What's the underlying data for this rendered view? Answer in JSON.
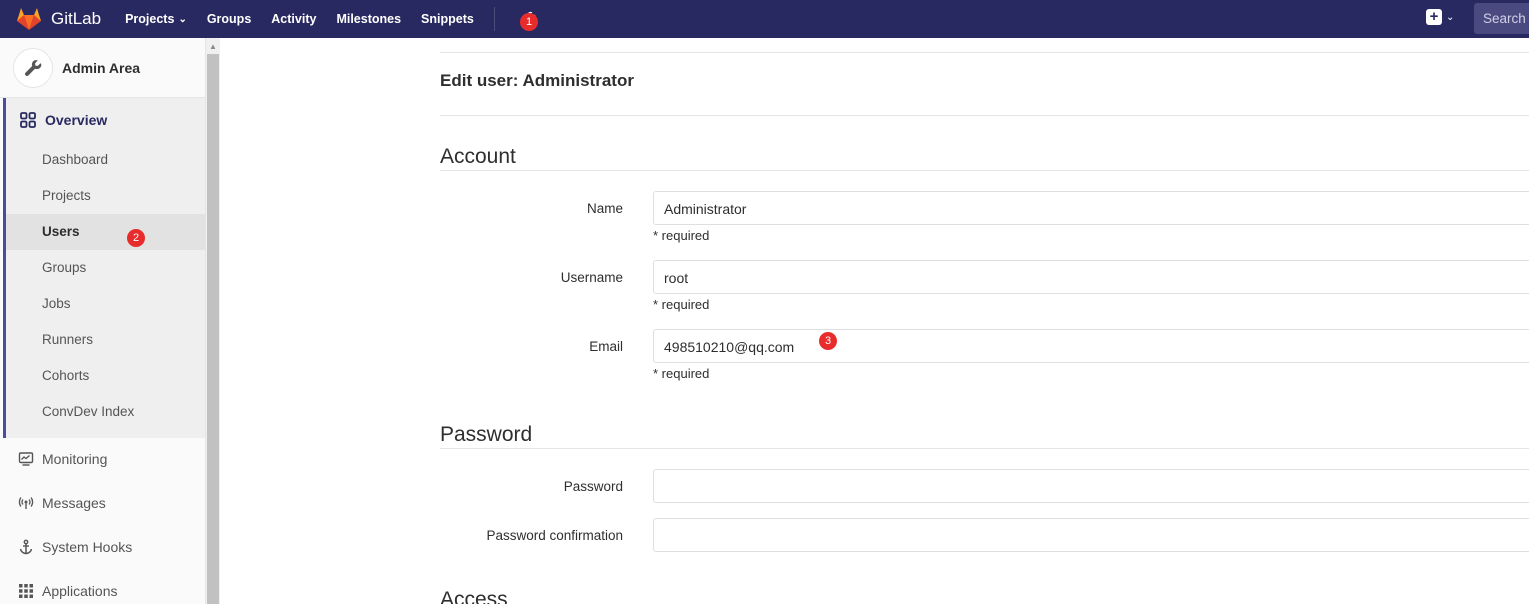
{
  "navbar": {
    "brand": "GitLab",
    "links": [
      "Projects",
      "Groups",
      "Activity",
      "Milestones",
      "Snippets"
    ],
    "admin_badge": "1",
    "search_placeholder": "Search",
    "colors": {
      "bg": "#292961",
      "badge": "#e82c2c"
    }
  },
  "sidebar": {
    "title": "Admin Area",
    "overview": {
      "label": "Overview",
      "items": [
        "Dashboard",
        "Projects",
        "Users",
        "Groups",
        "Jobs",
        "Runners",
        "Cohorts",
        "ConvDev Index"
      ],
      "active": "Users",
      "users_badge": "2"
    },
    "items": [
      {
        "label": "Monitoring",
        "icon": "monitor-icon"
      },
      {
        "label": "Messages",
        "icon": "broadcast-icon"
      },
      {
        "label": "System Hooks",
        "icon": "anchor-icon"
      },
      {
        "label": "Applications",
        "icon": "grid-icon"
      }
    ]
  },
  "main": {
    "title": "Edit user: Administrator",
    "account": {
      "heading": "Account",
      "fields": [
        {
          "label": "Name",
          "value": "Administrator",
          "help": "* required"
        },
        {
          "label": "Username",
          "value": "root",
          "help": "* required"
        },
        {
          "label": "Email",
          "value": "498510210@qq.com",
          "help": "* required"
        }
      ],
      "email_badge": "3"
    },
    "password": {
      "heading": "Password",
      "fields": [
        {
          "label": "Password",
          "value": ""
        },
        {
          "label": "Password confirmation",
          "value": ""
        }
      ]
    },
    "access": {
      "heading": "Access"
    }
  }
}
